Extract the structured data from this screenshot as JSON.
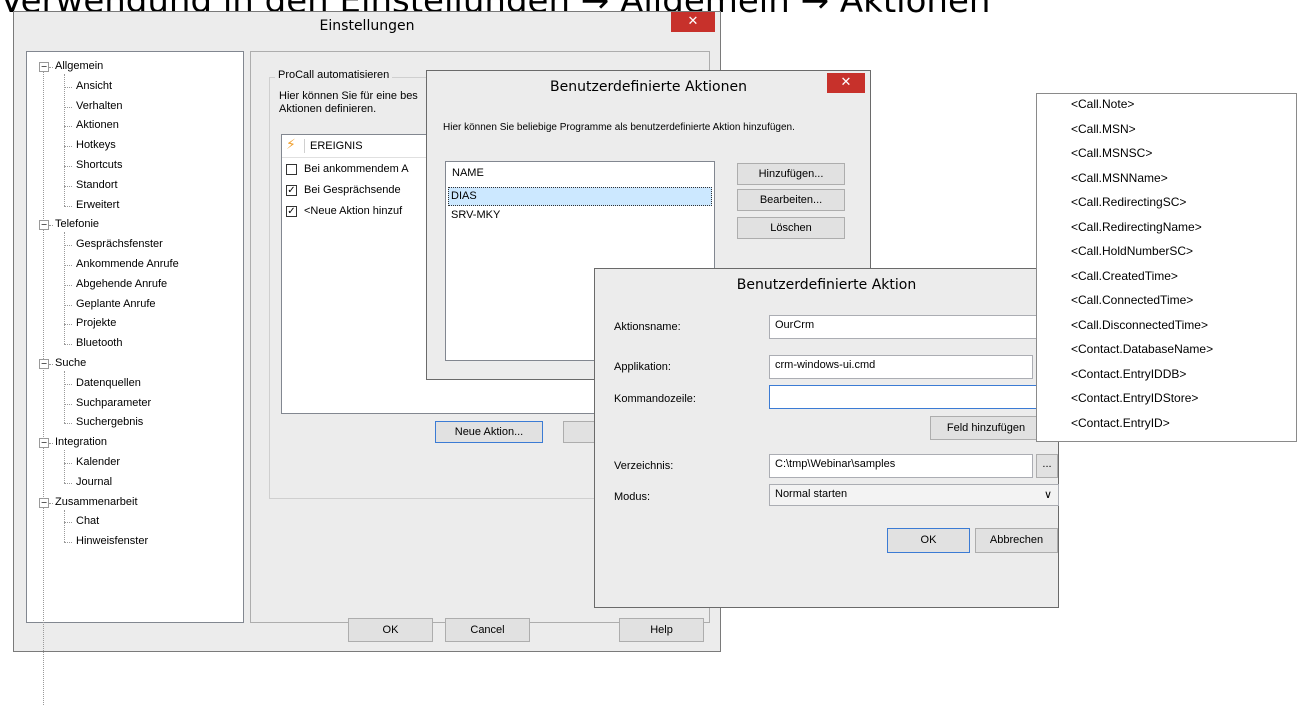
{
  "heading": "Verwendung in den Einstellungen → Allgemein → Aktionen",
  "settings": {
    "title": "Einstellungen",
    "close_glyph": "✕",
    "tree": {
      "expander_glyph": "−",
      "groups": [
        {
          "label": "Allgemein",
          "children": [
            "Ansicht",
            "Verhalten",
            "Aktionen",
            "Hotkeys",
            "Shortcuts",
            "Standort",
            "Erweitert"
          ]
        },
        {
          "label": "Telefonie",
          "children": [
            "Gesprächsfenster",
            "Ankommende Anrufe",
            "Abgehende Anrufe",
            "Geplante Anrufe",
            "Projekte",
            "Bluetooth"
          ]
        },
        {
          "label": "Suche",
          "children": [
            "Datenquellen",
            "Suchparameter",
            "Suchergebnis"
          ]
        },
        {
          "label": "Integration",
          "children": [
            "Kalender",
            "Journal"
          ]
        },
        {
          "label": "Zusammenarbeit",
          "children": [
            "Chat",
            "Hinweisfenster"
          ]
        }
      ]
    },
    "group_title": "ProCall automatisieren",
    "description_line1": "Hier können Sie für eine bes",
    "description_line2": "Aktionen definieren.",
    "events_header": "EREIGNIS",
    "events": [
      {
        "label": "Bei ankommendem A",
        "checked": false
      },
      {
        "label": "Bei Gesprächsende",
        "checked": true
      },
      {
        "label": "<Neue Aktion hinzuf",
        "checked": true
      }
    ],
    "check_glyph": "✓",
    "new_action_label": "Neue Aktion...",
    "ok_label": "OK",
    "cancel_label": "Cancel",
    "help_label": "Help"
  },
  "actions_dialog": {
    "title": "Benutzerdefinierte Aktionen",
    "close_glyph": "✕",
    "description": "Hier können Sie beliebige Programme als benutzerdefinierte Aktion hinzufügen.",
    "list_header": "NAME",
    "items": [
      "DIAS",
      "SRV-MKY"
    ],
    "add_label": "Hinzufügen...",
    "edit_label": "Bearbeiten...",
    "delete_label": "Löschen"
  },
  "action_dialog": {
    "title": "Benutzerdefinierte Aktion",
    "name_label": "Aktionsname:",
    "name_value": "OurCrm",
    "app_label": "Applikation:",
    "app_value": "crm-windows-ui.cmd",
    "cmd_label": "Kommandozeile:",
    "cmd_value": "",
    "add_field_label": "Feld hinzufügen",
    "dir_label": "Verzeichnis:",
    "dir_value": "C:\\tmp\\Webinar\\samples",
    "browse_label": "...",
    "mode_label": "Modus:",
    "mode_value": "Normal starten",
    "dropdown_glyph": "∨",
    "ok_label": "OK",
    "cancel_label": "Abbrechen"
  },
  "field_popup": {
    "items": [
      "<Call.Note>",
      "<Call.MSN>",
      "<Call.MSNSC>",
      "<Call.MSNName>",
      "<Call.RedirectingSC>",
      "<Call.RedirectingName>",
      "<Call.HoldNumberSC>",
      "<Call.CreatedTime>",
      "<Call.ConnectedTime>",
      "<Call.DisconnectedTime>",
      "<Contact.DatabaseName>",
      "<Contact.EntryIDDB>",
      "<Contact.EntryIDStore>",
      "<Contact.EntryID>"
    ]
  },
  "colors": {
    "close": "#c7312b",
    "selection": "#cce8ff",
    "lightning": "#f0a030"
  }
}
